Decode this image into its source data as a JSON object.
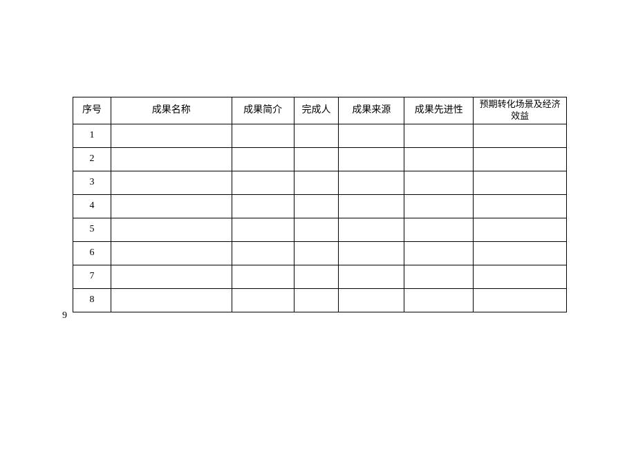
{
  "table": {
    "headers": {
      "seq": "序号",
      "name": "成果名称",
      "intro": "成果简介",
      "person": "完成人",
      "source": "成果来源",
      "advance": "成果先进性",
      "benefit": "预期转化场景及经济效益"
    },
    "rows": [
      {
        "seq": "1",
        "name": "",
        "intro": "",
        "person": "",
        "source": "",
        "advance": "",
        "benefit": ""
      },
      {
        "seq": "2",
        "name": "",
        "intro": "",
        "person": "",
        "source": "",
        "advance": "",
        "benefit": ""
      },
      {
        "seq": "3",
        "name": "",
        "intro": "",
        "person": "",
        "source": "",
        "advance": "",
        "benefit": ""
      },
      {
        "seq": "4",
        "name": "",
        "intro": "",
        "person": "",
        "source": "",
        "advance": "",
        "benefit": ""
      },
      {
        "seq": "5",
        "name": "",
        "intro": "",
        "person": "",
        "source": "",
        "advance": "",
        "benefit": ""
      },
      {
        "seq": "6",
        "name": "",
        "intro": "",
        "person": "",
        "source": "",
        "advance": "",
        "benefit": ""
      },
      {
        "seq": "7",
        "name": "",
        "intro": "",
        "person": "",
        "source": "",
        "advance": "",
        "benefit": ""
      },
      {
        "seq": "8",
        "name": "",
        "intro": "",
        "person": "",
        "source": "",
        "advance": "",
        "benefit": ""
      }
    ]
  },
  "page_number": "9"
}
